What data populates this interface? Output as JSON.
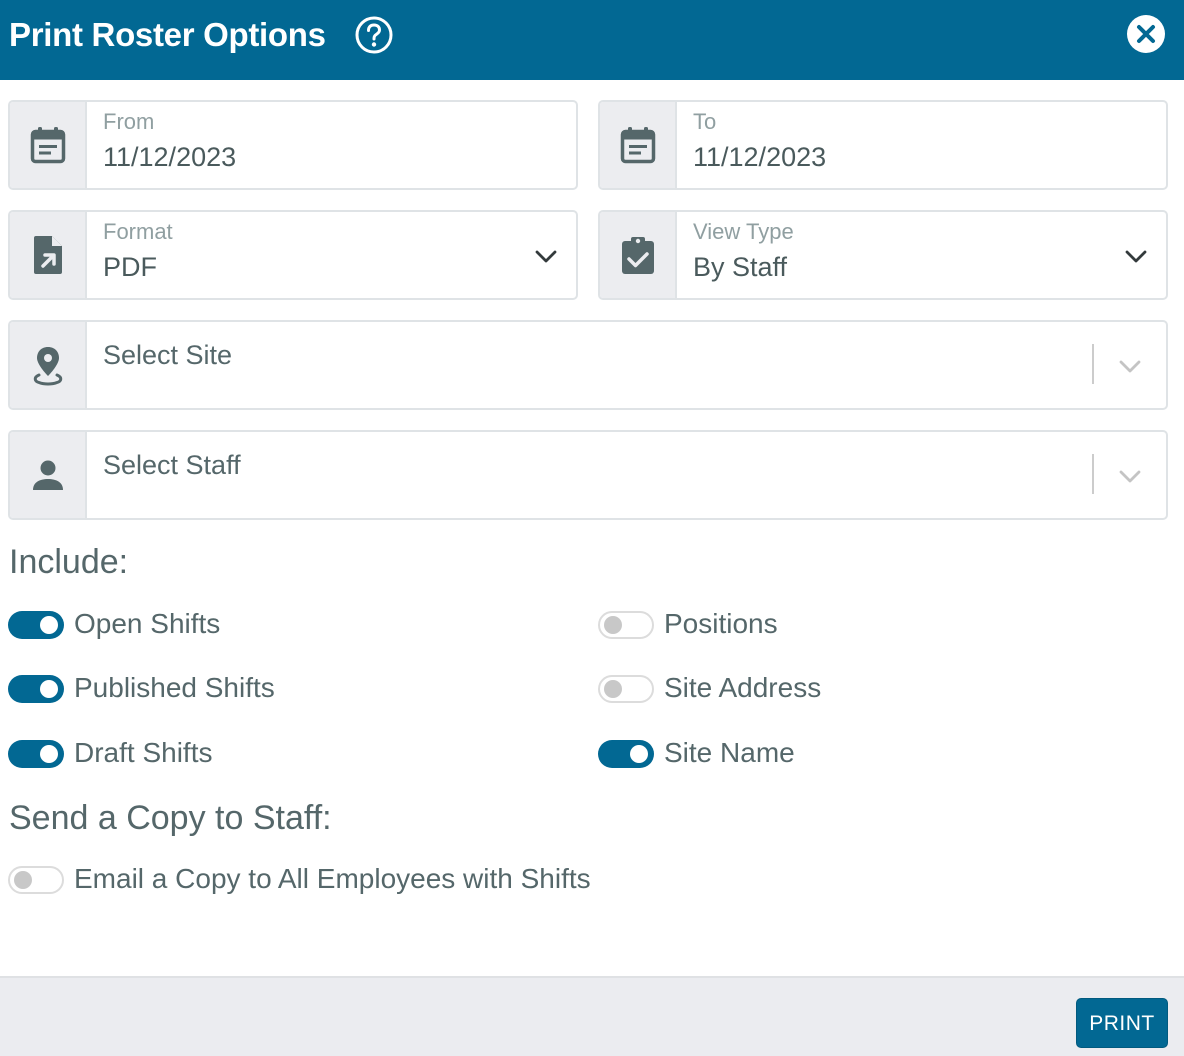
{
  "dialog": {
    "title": "Print Roster Options",
    "help_icon": "question-circle-icon",
    "close_icon": "close-circle-icon"
  },
  "fields": {
    "from": {
      "label": "From",
      "value": "11/12/2023",
      "icon": "calendar-icon"
    },
    "to": {
      "label": "To",
      "value": "11/12/2023",
      "icon": "calendar-icon"
    },
    "format": {
      "label": "Format",
      "value": "PDF",
      "icon": "file-export-icon"
    },
    "view_type": {
      "label": "View Type",
      "value": "By Staff",
      "icon": "clipboard-check-icon"
    },
    "site": {
      "placeholder": "Select Site",
      "icon": "map-marker-icon"
    },
    "staff": {
      "placeholder": "Select Staff",
      "icon": "person-icon"
    }
  },
  "include": {
    "title": "Include:",
    "options": [
      {
        "label": "Open Shifts",
        "on": true
      },
      {
        "label": "Published Shifts",
        "on": true
      },
      {
        "label": "Draft Shifts",
        "on": true
      },
      {
        "label": "Positions",
        "on": false
      },
      {
        "label": "Site Address",
        "on": false
      },
      {
        "label": "Site Name",
        "on": true
      }
    ]
  },
  "send_copy": {
    "title": "Send a Copy to Staff:",
    "options": [
      {
        "label": "Email a Copy to All Employees with Shifts",
        "on": false
      }
    ]
  },
  "footer": {
    "print_label": "PRINT"
  },
  "colors": {
    "primary": "#026893",
    "text": "#55676a",
    "muted": "#909fa1",
    "addon_bg": "#ecedf0"
  }
}
